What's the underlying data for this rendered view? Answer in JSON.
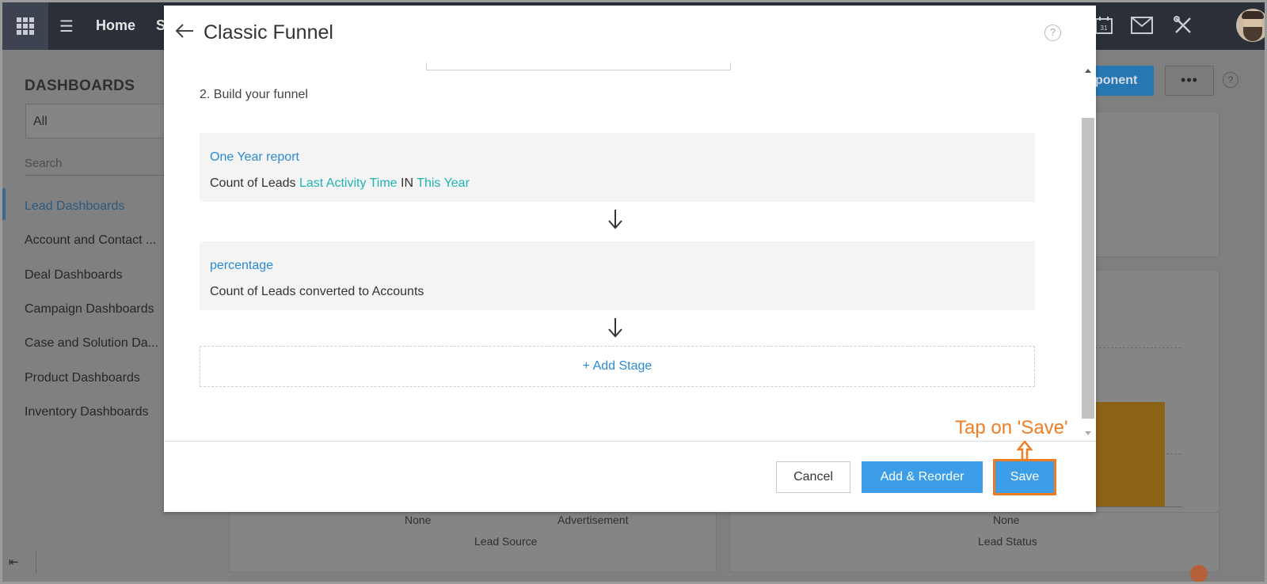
{
  "topbar": {
    "home_label": "Home",
    "next_nav_label": "S",
    "calendar_day": "31"
  },
  "sidebar": {
    "heading": "DASHBOARDS",
    "filter_value": "All",
    "search_placeholder": "Search",
    "items": [
      {
        "label": "Lead Dashboards",
        "active": true
      },
      {
        "label": "Account and Contact ..."
      },
      {
        "label": "Deal Dashboards"
      },
      {
        "label": "Campaign Dashboards"
      },
      {
        "label": "Case and Solution Da..."
      },
      {
        "label": "Product Dashboards"
      },
      {
        "label": "Inventory Dashboards"
      }
    ],
    "collapse_glyph": "⇤"
  },
  "background": {
    "component_button_label": "ponent",
    "more_label": "•••",
    "help_label": "?",
    "chart_left": {
      "x_ticks": [
        "None",
        "Advertisement"
      ],
      "x_title": "Lead Source"
    },
    "chart_right": {
      "x_ticks": [
        "None"
      ],
      "x_title": "Lead Status"
    }
  },
  "modal": {
    "title": "Classic Funnel",
    "help_label": "?",
    "section_label": "2. Build your funnel",
    "stages": [
      {
        "name": "One Year report",
        "criteria_prefix": "Count of Leads",
        "criteria_field": "Last Activity Time",
        "criteria_operator": "IN",
        "criteria_value": "This Year"
      },
      {
        "name": "percentage",
        "criteria_prefix": "Count of Leads converted to Accounts"
      }
    ],
    "add_stage_label": "+ Add Stage",
    "buttons": {
      "cancel": "Cancel",
      "add_reorder": "Add & Reorder",
      "save": "Save"
    }
  },
  "annotation": {
    "text": "Tap on 'Save'"
  },
  "colors": {
    "accent_blue": "#3c9de8",
    "link_blue": "#2a8ad2",
    "teal": "#21b3b3",
    "annotation_orange": "#f07d22"
  }
}
